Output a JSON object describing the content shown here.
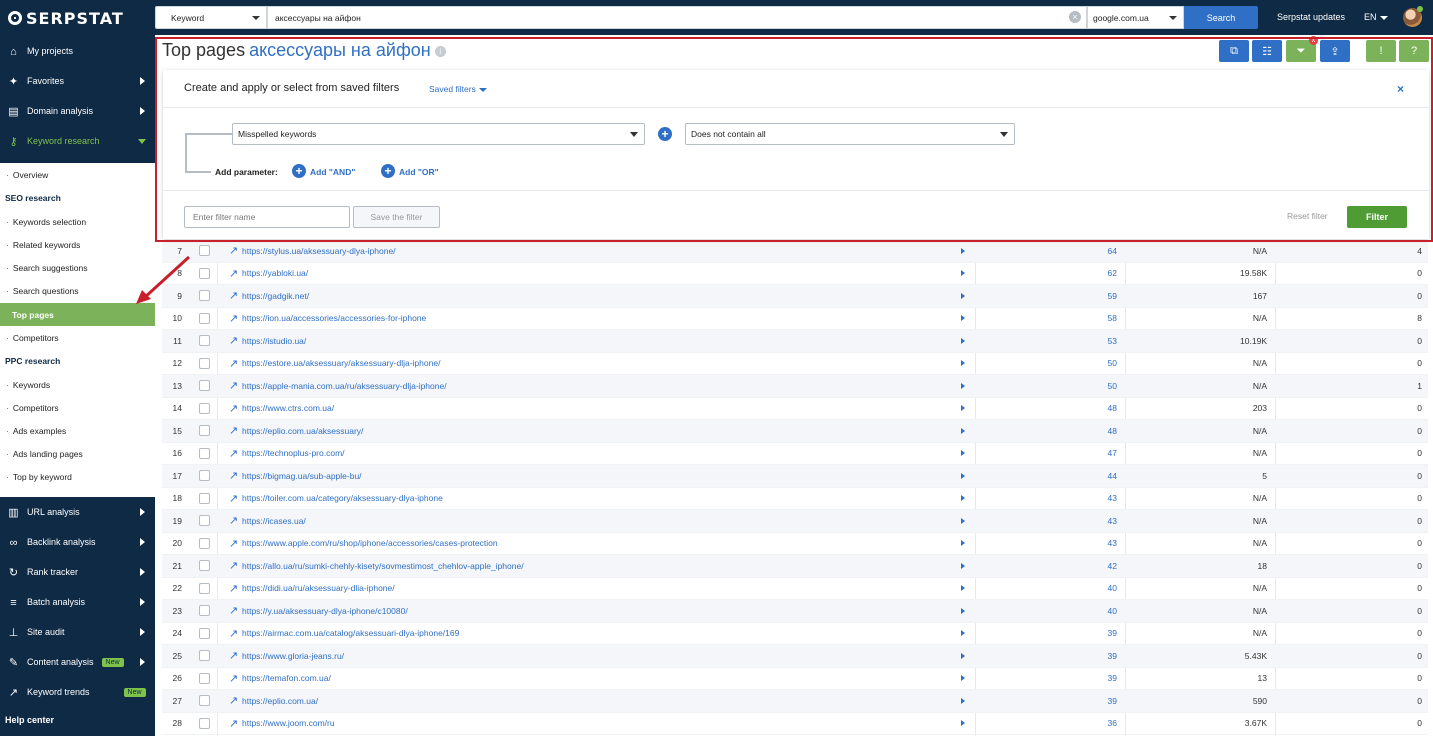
{
  "topbar": {
    "logo": "SERPSTAT",
    "search_type": "Keyword",
    "query": "аксессуары на айфон",
    "domain": "google.com.ua",
    "search_label": "Search",
    "updates_label": "Serpstat updates",
    "lang": "EN"
  },
  "sidebar": {
    "main_top": [
      {
        "label": "My projects",
        "icon": "home-icon"
      },
      {
        "label": "Favorites",
        "icon": "pin-icon"
      },
      {
        "label": "Domain analysis",
        "icon": "domain-chart-icon"
      },
      {
        "label": "Keyword research",
        "icon": "key-icon"
      }
    ],
    "sub": [
      {
        "label": "Overview",
        "type": "item"
      },
      {
        "label": "SEO research",
        "type": "head"
      },
      {
        "label": "Keywords selection",
        "type": "item"
      },
      {
        "label": "Related keywords",
        "type": "item"
      },
      {
        "label": "Search suggestions",
        "type": "item"
      },
      {
        "label": "Search questions",
        "type": "item"
      },
      {
        "label": "Top pages",
        "type": "active"
      },
      {
        "label": "Competitors",
        "type": "item"
      },
      {
        "label": "PPC research",
        "type": "head"
      },
      {
        "label": "Keywords",
        "type": "item"
      },
      {
        "label": "Competitors",
        "type": "item"
      },
      {
        "label": "Ads examples",
        "type": "item"
      },
      {
        "label": "Ads landing pages",
        "type": "item"
      },
      {
        "label": "Top by keyword",
        "type": "item"
      }
    ],
    "main_bottom": [
      {
        "label": "URL analysis",
        "icon": "bar-chart-icon",
        "badge": ""
      },
      {
        "label": "Backlink analysis",
        "icon": "link-icon",
        "badge": ""
      },
      {
        "label": "Rank tracker",
        "icon": "refresh-icon",
        "badge": ""
      },
      {
        "label": "Batch analysis",
        "icon": "database-icon",
        "badge": ""
      },
      {
        "label": "Site audit",
        "icon": "sitemap-icon",
        "badge": ""
      },
      {
        "label": "Content analysis",
        "icon": "pen-icon",
        "badge": "New"
      },
      {
        "label": "Keyword trends",
        "icon": "trend-icon",
        "badge": "New"
      }
    ],
    "help": "Help center"
  },
  "page": {
    "title": "Top pages",
    "keyword": "аксессуары на айфон",
    "toolbar_badge": "x"
  },
  "filter": {
    "title": "Create and apply or select from saved filters",
    "saved_filters": "Saved filters",
    "param": "Misspelled keywords",
    "condition": "Does not contain all",
    "add_param": "Add parameter:",
    "add_and": "Add \"AND\"",
    "add_or": "Add \"OR\"",
    "name_placeholder": "Enter filter name",
    "save_label": "Save the filter",
    "reset_label": "Reset filter",
    "apply_label": "Filter"
  },
  "table": {
    "rows": [
      {
        "n": "7",
        "url": "https://stylus.ua/aksessuary-dlya-iphone/",
        "v1": "64",
        "v2": "N/A",
        "v3": "4"
      },
      {
        "n": "8",
        "url": "https://yabloki.ua/",
        "v1": "62",
        "v2": "19.58K",
        "v3": "0"
      },
      {
        "n": "9",
        "url": "https://gadgik.net/",
        "v1": "59",
        "v2": "167",
        "v3": "0"
      },
      {
        "n": "10",
        "url": "https://ion.ua/accessories/accessories-for-iphone",
        "v1": "58",
        "v2": "N/A",
        "v3": "8"
      },
      {
        "n": "11",
        "url": "https://istudio.ua/",
        "v1": "53",
        "v2": "10.19K",
        "v3": "0"
      },
      {
        "n": "12",
        "url": "https://estore.ua/aksessuary/aksessuary-dlja-iphone/",
        "v1": "50",
        "v2": "N/A",
        "v3": "0"
      },
      {
        "n": "13",
        "url": "https://apple-mania.com.ua/ru/aksessuary-dlja-iphone/",
        "v1": "50",
        "v2": "N/A",
        "v3": "1"
      },
      {
        "n": "14",
        "url": "https://www.ctrs.com.ua/",
        "v1": "48",
        "v2": "203",
        "v3": "0"
      },
      {
        "n": "15",
        "url": "https://eplio.com.ua/aksessuary/",
        "v1": "48",
        "v2": "N/A",
        "v3": "0"
      },
      {
        "n": "16",
        "url": "https://technoplus-pro.com/",
        "v1": "47",
        "v2": "N/A",
        "v3": "0"
      },
      {
        "n": "17",
        "url": "https://bigmag.ua/sub-apple-bu/",
        "v1": "44",
        "v2": "5",
        "v3": "0"
      },
      {
        "n": "18",
        "url": "https://toiler.com.ua/category/aksessuary-dlya-iphone",
        "v1": "43",
        "v2": "N/A",
        "v3": "0"
      },
      {
        "n": "19",
        "url": "https://icases.ua/",
        "v1": "43",
        "v2": "N/A",
        "v3": "0"
      },
      {
        "n": "20",
        "url": "https://www.apple.com/ru/shop/iphone/accessories/cases-protection",
        "v1": "43",
        "v2": "N/A",
        "v3": "0"
      },
      {
        "n": "21",
        "url": "https://allo.ua/ru/sumki-chehly-kisety/sovmestimost_chehlov-apple_iphone/",
        "v1": "42",
        "v2": "18",
        "v3": "0"
      },
      {
        "n": "22",
        "url": "https://didi.ua/ru/aksessuary-dlia-iphone/",
        "v1": "40",
        "v2": "N/A",
        "v3": "0"
      },
      {
        "n": "23",
        "url": "https://y.ua/aksessuary-dlya-iphone/c10080/",
        "v1": "40",
        "v2": "N/A",
        "v3": "0"
      },
      {
        "n": "24",
        "url": "https://airmac.com.ua/catalog/aksessuari-dlya-iphone/169",
        "v1": "39",
        "v2": "N/A",
        "v3": "0"
      },
      {
        "n": "25",
        "url": "https://www.gloria-jeans.ru/",
        "v1": "39",
        "v2": "5.43K",
        "v3": "0"
      },
      {
        "n": "26",
        "url": "https://temafon.com.ua/",
        "v1": "39",
        "v2": "13",
        "v3": "0"
      },
      {
        "n": "27",
        "url": "https://eplio.com.ua/",
        "v1": "39",
        "v2": "590",
        "v3": "0"
      },
      {
        "n": "28",
        "url": "https://www.joom.com/ru",
        "v1": "36",
        "v2": "3.67K",
        "v3": "0"
      }
    ]
  },
  "colors": {
    "nav_bg": "#0f2a44",
    "accent_blue": "#2f6fc6",
    "accent_green": "#7cb35a",
    "highlight_red": "#c8202a"
  }
}
